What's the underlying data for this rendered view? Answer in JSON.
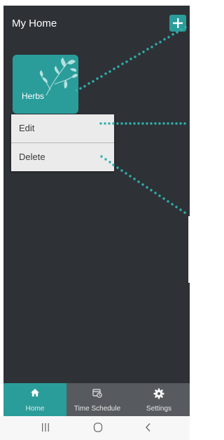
{
  "header": {
    "title": "My Home",
    "add_icon": "plus-icon"
  },
  "card": {
    "label": "Herbs",
    "image": "herb-leaves-illustration"
  },
  "context_menu": {
    "items": [
      {
        "label": "Edit"
      },
      {
        "label": "Delete"
      }
    ]
  },
  "bottom_nav": {
    "items": [
      {
        "label": "Home",
        "icon": "home-icon",
        "active": true
      },
      {
        "label": "Time Schedule",
        "icon": "schedule-icon",
        "active": false
      },
      {
        "label": "Settings",
        "icon": "gear-icon",
        "active": false
      }
    ]
  },
  "system_nav": {
    "icons": [
      "recent-apps-icon",
      "home-circle-icon",
      "back-icon"
    ]
  },
  "colors": {
    "accent": "#2a9d9a",
    "background": "#2e3236",
    "nav_bar": "#575b5f",
    "menu": "#ebebeb"
  }
}
